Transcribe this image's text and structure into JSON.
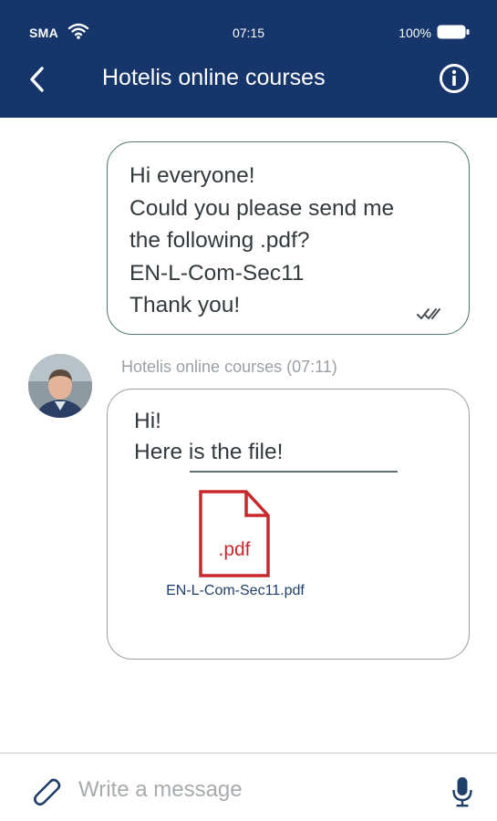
{
  "status_bar": {
    "carrier": "SMA",
    "time": "07:15",
    "battery": "100%"
  },
  "header": {
    "title": "Hotelis online courses"
  },
  "messages": {
    "outgoing": {
      "lines": [
        "Hi everyone!",
        "Could you please send me",
        "the following .pdf?",
        "EN-L-Com-Sec11",
        "Thank you!"
      ]
    },
    "incoming": {
      "sender": "Hotelis online courses (07:11)",
      "lines": [
        "Hi!",
        "Here is the file!"
      ],
      "file_label": ".pdf",
      "file_name": "EN-L-Com-Sec11.pdf"
    }
  },
  "composer": {
    "placeholder": "Write a message"
  },
  "colors": {
    "header": "#16356a",
    "pdf_red": "#c8282d",
    "outgoing_border": "#4c7a6a",
    "incoming_border": "#9aa0a6"
  }
}
